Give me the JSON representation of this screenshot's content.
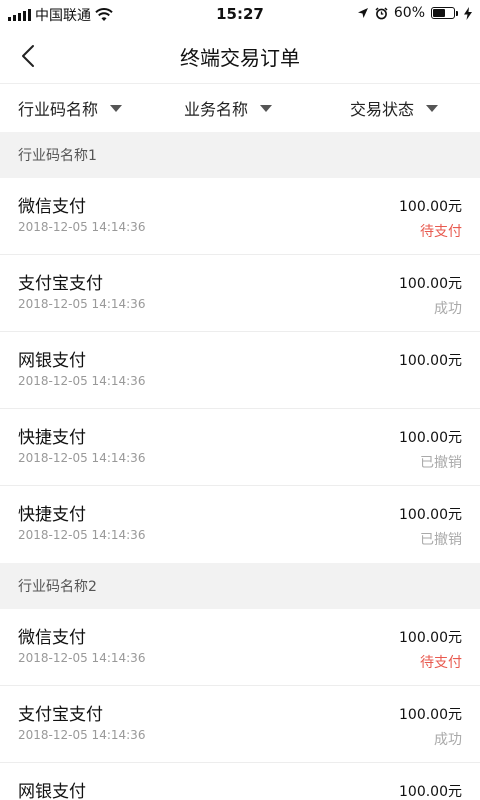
{
  "status_bar": {
    "carrier": "中国联通",
    "time": "15:27",
    "battery": "60%",
    "battery_level": 0.6,
    "icons": [
      "signal-icon",
      "wifi-icon",
      "location-icon",
      "alarm-icon",
      "battery-icon",
      "charging-icon"
    ]
  },
  "nav": {
    "title": "终端交易订单",
    "back_icon": "chevron-left-icon"
  },
  "filters": [
    {
      "label": "行业码名称"
    },
    {
      "label": "业务名称"
    },
    {
      "label": "交易状态"
    }
  ],
  "groups": [
    {
      "title": "行业码名称1",
      "items": [
        {
          "name": "微信支付",
          "date": "2018-12-05 14:14:36",
          "amount": "100.00元",
          "status": "待支付",
          "status_type": "pending"
        },
        {
          "name": "支付宝支付",
          "date": "2018-12-05 14:14:36",
          "amount": "100.00元",
          "status": "成功",
          "status_type": "done"
        },
        {
          "name": "网银支付",
          "date": "2018-12-05 14:14:36",
          "amount": "100.00元",
          "status": "",
          "status_type": "none"
        },
        {
          "name": "快捷支付",
          "date": "2018-12-05 14:14:36",
          "amount": "100.00元",
          "status": "已撤销",
          "status_type": "done"
        },
        {
          "name": "快捷支付",
          "date": "2018-12-05 14:14:36",
          "amount": "100.00元",
          "status": "已撤销",
          "status_type": "done"
        }
      ]
    },
    {
      "title": "行业码名称2",
      "items": [
        {
          "name": "微信支付",
          "date": "2018-12-05 14:14:36",
          "amount": "100.00元",
          "status": "待支付",
          "status_type": "pending"
        },
        {
          "name": "支付宝支付",
          "date": "2018-12-05 14:14:36",
          "amount": "100.00元",
          "status": "成功",
          "status_type": "done"
        },
        {
          "name": "网银支付",
          "date": "",
          "amount": "100.00元",
          "status": "",
          "status_type": "none"
        }
      ]
    }
  ],
  "colors": {
    "pending": "#e85a4f",
    "muted": "#aaaaaa",
    "group_bg": "#f2f2f2"
  }
}
